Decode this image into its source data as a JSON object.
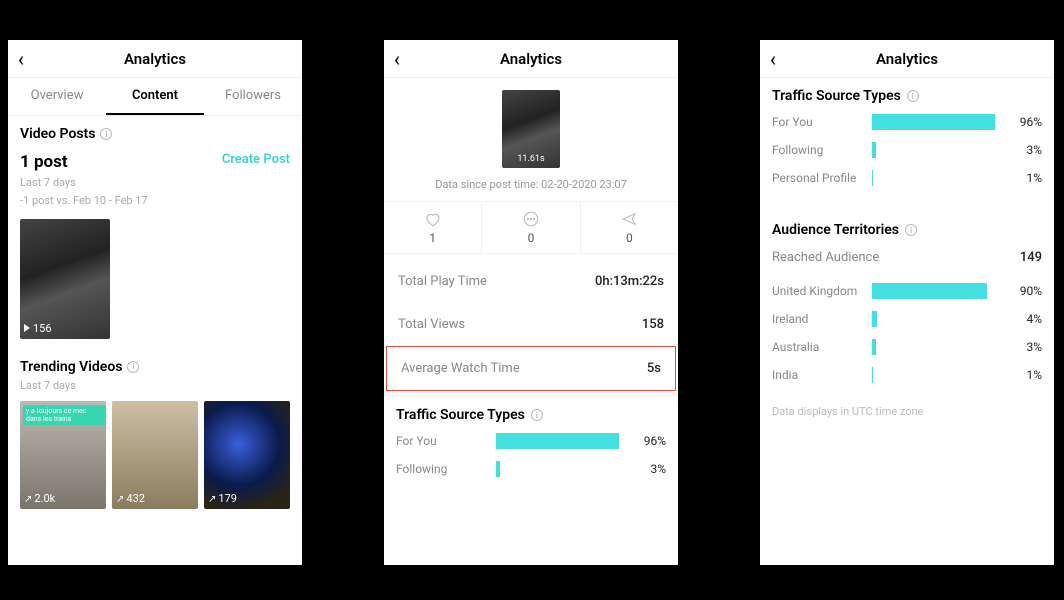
{
  "panel1": {
    "title": "Analytics",
    "tabs": {
      "overview": "Overview",
      "content": "Content",
      "followers": "Followers"
    },
    "video_posts": {
      "heading": "Video Posts",
      "count_label": "1 post",
      "period": "Last 7 days",
      "delta": "-1 post vs. Feb 10 - Feb 17",
      "create": "Create Post",
      "thumb_views": "156"
    },
    "trending": {
      "heading": "Trending Videos",
      "period": "Last 7 days",
      "items": [
        {
          "tag": "y a toujours ce mec dans les trains",
          "views": "2.0k"
        },
        {
          "views": "432"
        },
        {
          "views": "179"
        }
      ]
    }
  },
  "panel2": {
    "title": "Analytics",
    "duration": "11.61s",
    "since": "Data since post time: 02-20-2020 23:07",
    "stats": {
      "likes": "1",
      "comments": "0",
      "shares": "0"
    },
    "metrics": [
      {
        "label": "Total Play Time",
        "value": "0h:13m:22s"
      },
      {
        "label": "Total Views",
        "value": "158"
      },
      {
        "label": "Average Watch Time",
        "value": "5s",
        "highlight": true
      }
    ],
    "traffic_heading": "Traffic Source Types",
    "traffic": [
      {
        "label": "For You",
        "pct": 96
      },
      {
        "label": "Following",
        "pct": 3
      }
    ]
  },
  "panel3": {
    "title": "Analytics",
    "traffic_heading": "Traffic Source Types",
    "traffic": [
      {
        "label": "For You",
        "pct": 96
      },
      {
        "label": "Following",
        "pct": 3
      },
      {
        "label": "Personal Profile",
        "pct": 1
      }
    ],
    "territories_heading": "Audience Territories",
    "reached_label": "Reached Audience",
    "reached_value": "149",
    "territories": [
      {
        "label": "United Kingdom",
        "pct": 90
      },
      {
        "label": "Ireland",
        "pct": 4
      },
      {
        "label": "Australia",
        "pct": 3
      },
      {
        "label": "India",
        "pct": 1
      }
    ],
    "utc_note": "Data displays in UTC time zone"
  }
}
